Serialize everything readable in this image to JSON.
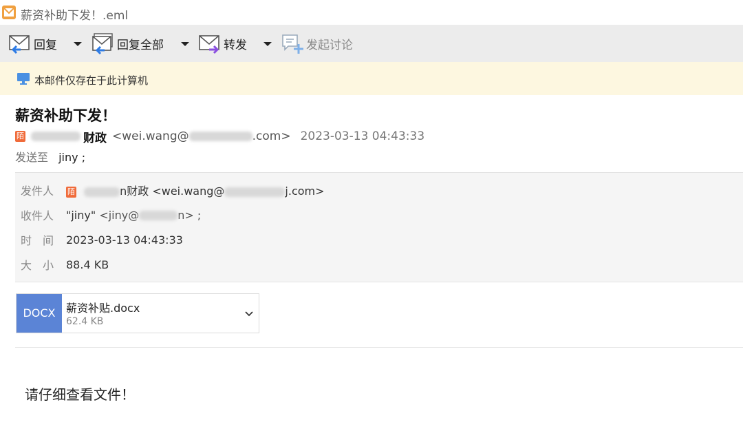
{
  "window": {
    "title": "薪资补助下发！.eml",
    "app_icon": "mail-app-icon"
  },
  "toolbar": {
    "reply_label": "回复",
    "reply_all_label": "回复全部",
    "forward_label": "转发",
    "discuss_label": "发起讨论",
    "icons": [
      "reply-icon",
      "reply-all-icon",
      "forward-icon",
      "discussion-icon",
      "caret-down-icon"
    ]
  },
  "notice": {
    "text": "本邮件仅存在于此计算机",
    "icon": "monitor-icon"
  },
  "email": {
    "subject": "薪资补助下发！",
    "sender_badge": "陌",
    "sender_name_suffix": "财政",
    "sender_email_prefix": "<wei.wang@",
    "sender_email_suffix": ".com>",
    "date": "2023-03-13 04:43:33",
    "to_label": "发送至",
    "to_value": "jiny ;"
  },
  "details": {
    "from_label": "发件人",
    "from_badge": "陌",
    "from_name_suffix": "n财政",
    "from_email_prefix": "<wei.wang@",
    "from_email_suffix": "j.com>",
    "to_label": "收件人",
    "to_name": "\"jiny\"",
    "to_email_prefix": "<jiny@",
    "to_email_suffix": "n> ;",
    "time_label": "时　间",
    "time_value": "2023-03-13 04:43:33",
    "size_label": "大　小",
    "size_value": "88.4 KB"
  },
  "attachment": {
    "type": "DOCX",
    "name": "薪资补贴.docx",
    "size": "62.4 KB",
    "icon": "chevron-down-icon"
  },
  "body": {
    "text": "请仔细查看文件！"
  },
  "colors": {
    "toolbar_bg": "#ececec",
    "notice_bg": "#fdf7e0",
    "docx_blue": "#5b84d6",
    "badge_orange": "#f06b3a",
    "icon_blue": "#2d7be5",
    "icon_purple": "#8a4fe0"
  }
}
